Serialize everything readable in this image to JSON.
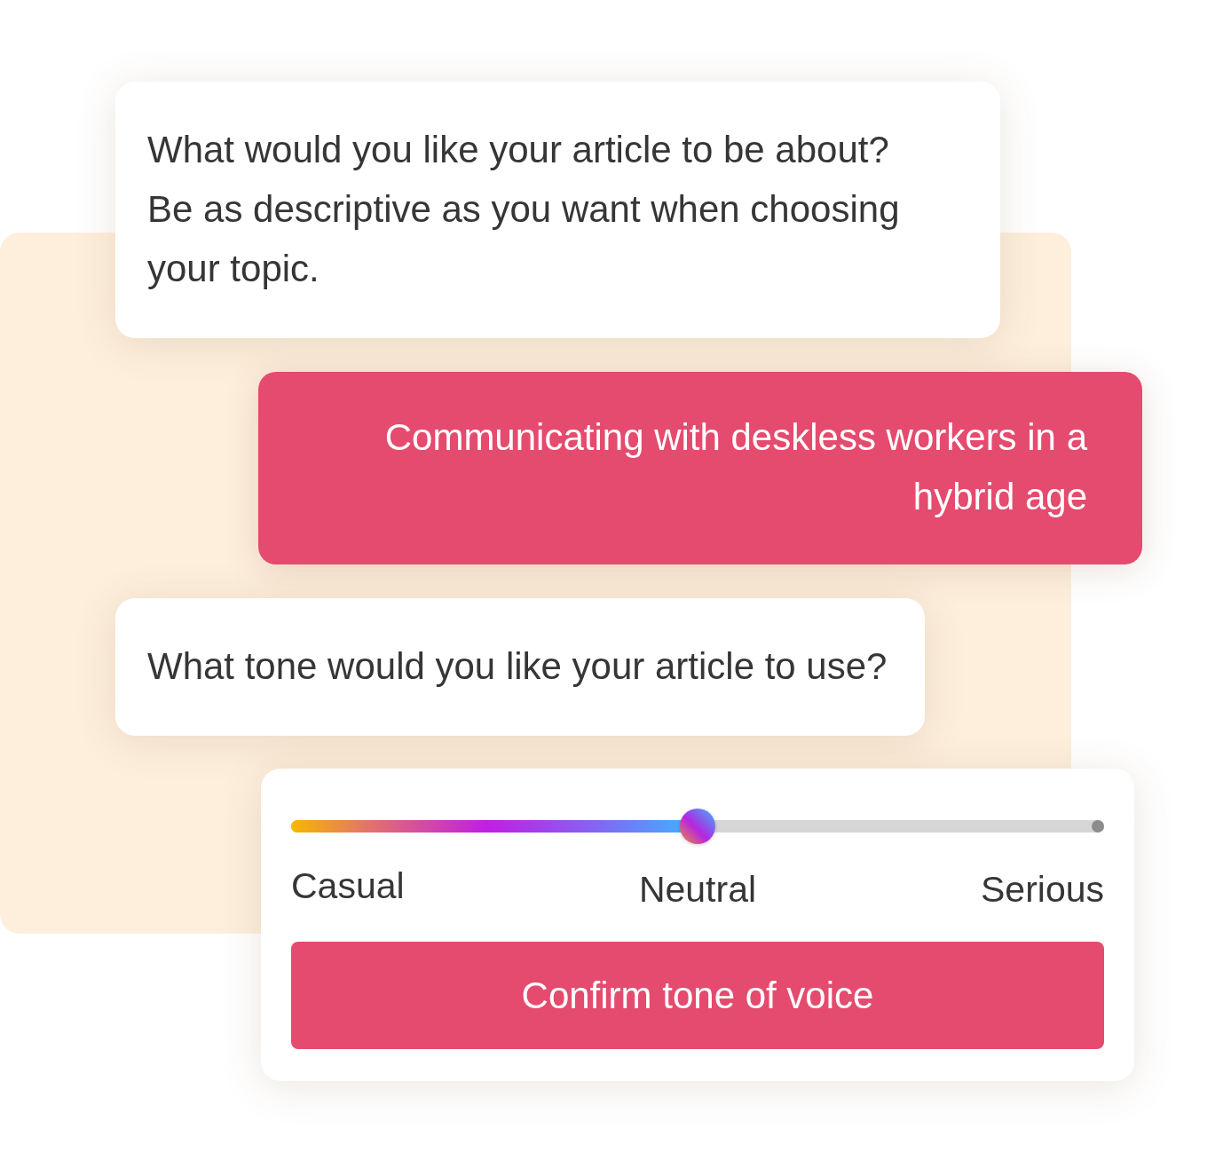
{
  "messages": [
    {
      "kind": "question",
      "text": "What would you like your article to be about?\nBe as descriptive as you want when choosing your topic."
    },
    {
      "kind": "answer",
      "text": "Communicating with deskless workers in a hybrid age"
    },
    {
      "kind": "question",
      "text": "What tone would you like your article to use?"
    }
  ],
  "tone_picker": {
    "slider": {
      "level": 0.5
    },
    "labels": [
      "Casual",
      "Neutral",
      "Serious"
    ],
    "button": "Confirm tone of voice"
  }
}
